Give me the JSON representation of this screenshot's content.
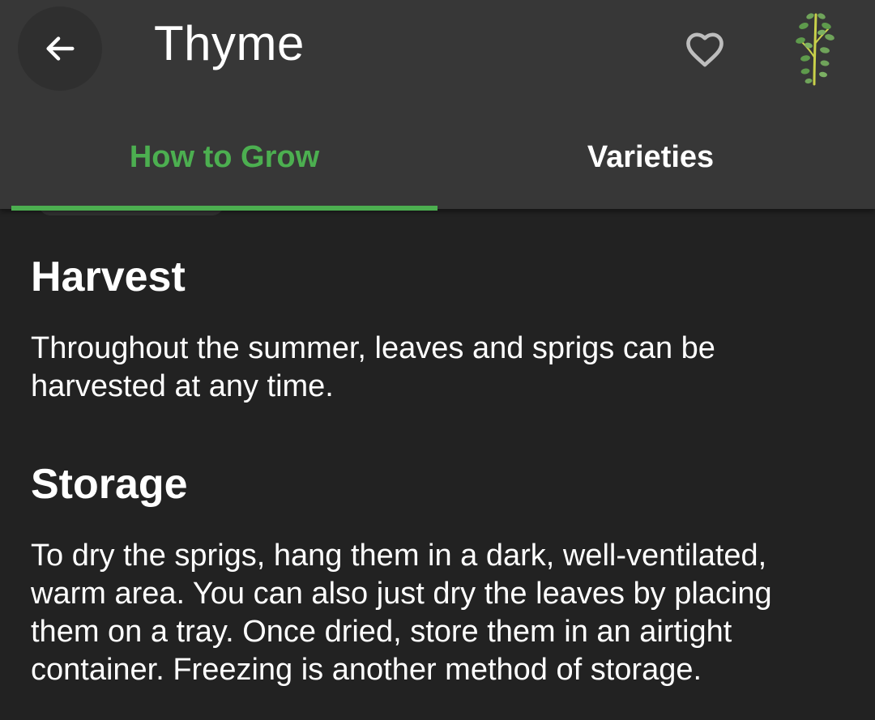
{
  "appbar": {
    "title": "Thyme",
    "back_icon": "arrow-left-icon",
    "favorite_icon": "heart-outline-icon",
    "plant_icon": "thyme-sprig-icon"
  },
  "tabs": [
    {
      "label": "How to Grow",
      "active": true
    },
    {
      "label": "Varieties",
      "active": false
    }
  ],
  "colors": {
    "accent": "#4caf50",
    "appbar_bg": "#373737",
    "page_bg": "#222222",
    "text": "#ffffff"
  },
  "sections": [
    {
      "heading": "Harvest",
      "body": "Throughout the summer, leaves and sprigs can be harvested at any time."
    },
    {
      "heading": "Storage",
      "body": "To dry the sprigs, hang them in a dark, well-ventilated, warm area. You can also just dry the leaves by placing them on a tray. Once dried, store them in an airtight container. Freezing is another method of storage."
    }
  ]
}
